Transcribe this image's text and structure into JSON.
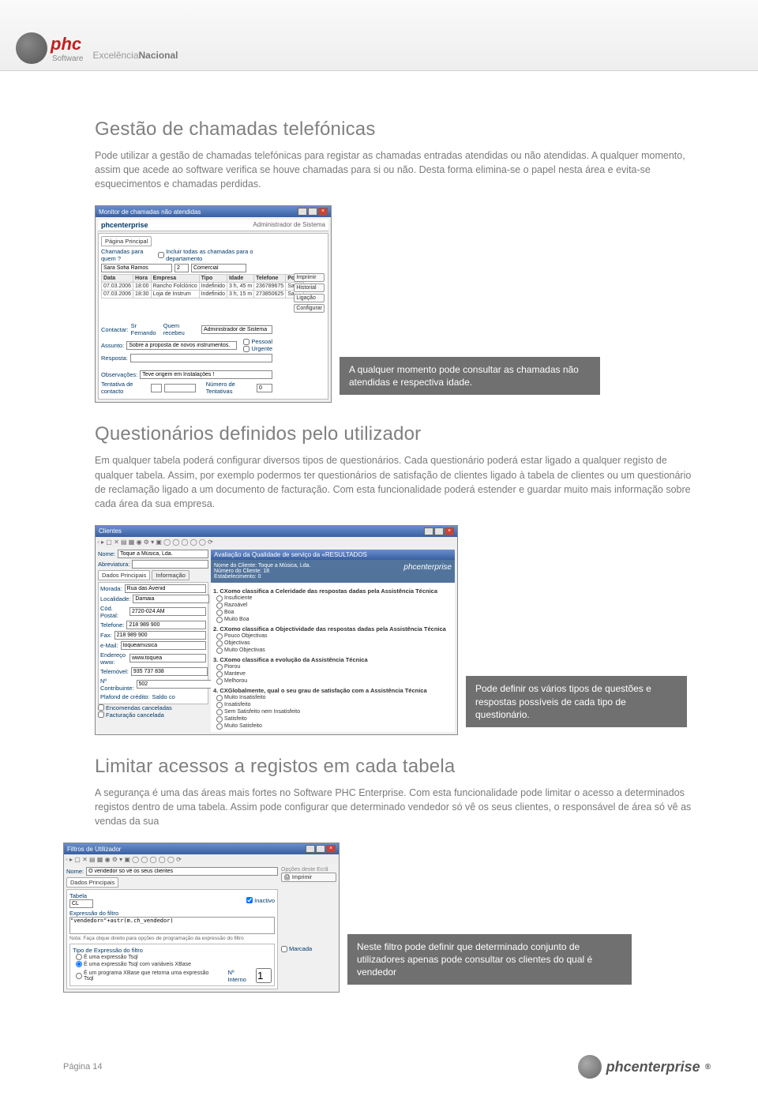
{
  "header": {
    "logo_text": "phc",
    "logo_sub": "Software",
    "tagline_light": "Excelência",
    "tagline_bold": "Nacional"
  },
  "sections": {
    "s1": {
      "title": "Gestão de chamadas telefónicas",
      "text": "Pode utilizar a gestão de chamadas telefónicas para registar as chamadas entradas atendidas ou não atendidas. A qualquer momento, assim que acede ao software verifica se houve chamadas para si ou não. Desta forma elimina-se o papel nesta área e evita-se esquecimentos e chamadas perdidas.",
      "caption": "A qualquer momento pode consultar as chamadas não atendidas e respectiva idade."
    },
    "s2": {
      "title": "Questionários definidos pelo utilizador",
      "text": "Em qualquer tabela poderá configurar diversos tipos de questionários. Cada questionário poderá estar ligado a qualquer registo de qualquer tabela. Assim, por exemplo podermos ter questionários de satisfação de clientes ligado à tabela de clientes ou um questionário de reclamação ligado a um documento de facturação. Com esta funcionalidade poderá estender e guardar muito mais informação sobre cada área da sua empresa.",
      "caption": "Pode definir os vários tipos de questões e respostas possíveis de cada tipo de questionário."
    },
    "s3": {
      "title": "Limitar acessos a registos em cada tabela",
      "text": "A segurança é uma das áreas mais fortes no Software PHC Enterprise. Com esta funcionalidade pode limitar o acesso a determinados registos dentro de uma tabela. Assim pode configurar que determinado vendedor só vê os seus clientes, o responsável de área só vê as vendas da sua",
      "caption": "Neste filtro pode definir que determinado conjunto de utilizadores apenas pode consultar os clientes do qual é vendedor"
    }
  },
  "win1": {
    "title": "Monitor de chamadas não atendidas",
    "brand": "phcenterprise",
    "role": "Administrador de Sistema",
    "tab": "Página Principal",
    "label_quem": "Chamadas para quem ?",
    "person": "Sara Sofia Ramos",
    "chk_all": "Incluir todas as chamadas para o departamento",
    "dept": "Comercial",
    "cols": [
      "Data",
      "Hora",
      "Empresa",
      "Tipo",
      "Idade",
      "Telefone",
      "Por a"
    ],
    "rows": [
      [
        "07.03.2006",
        "18:00",
        "Rancho Folclórico",
        "Indefinido",
        "3 h, 45 m",
        "236789675",
        "Sa"
      ],
      [
        "07.03.2006",
        "18:30",
        "Loja de Instrum",
        "Indefinido",
        "3 h, 15 m",
        "273850625",
        "Sa"
      ]
    ],
    "label_contactar": "Contactar:",
    "contactar": "Sr Fernando",
    "label_quem_rec": "Quem recebeu",
    "quem_rec": "Administrador de Sistema",
    "label_assunto": "Assunto:",
    "assunto": "Sobre a proposta de novos instrumentos.",
    "chk_pessoal": "Pessoal",
    "chk_urgente": "Urgente",
    "label_resposta": "Resposta:",
    "label_obs": "Observações:",
    "obs": "Teve origem em Instalações !",
    "label_tentativa": "Tentativa de contacto",
    "label_numtent": "Número de Tentativas",
    "num_tent": "0",
    "side": [
      "Imprimir",
      "Historial",
      "Ligação",
      "Configurar"
    ]
  },
  "win2": {
    "title": "Clientes",
    "brand": "phcenterprise",
    "panel_title": "Avaliação da Qualidade de serviço da «RESULTADOS",
    "nome_label": "Nome:",
    "nome": "Toque a Música, Lda.",
    "abrev_label": "Abreviatura:",
    "head_cli": "Nome do Cliente: Toque a Música, Lda.",
    "head_num": "Número do Cliente: 18",
    "head_est": "Estabelecimento: 0",
    "tab1": "Dados Principais",
    "tab2": "Informação",
    "morada_label": "Morada:",
    "morada": "Rua das Avenid",
    "local_label": "Localidade:",
    "local": "Damaia",
    "cp_label": "Cód. Postal:",
    "cp": "2720-024 AM",
    "tel_label": "Telefone:",
    "tel": "218 989 900",
    "fax_label": "Fax:",
    "fax": "218 989 900",
    "email_label": "e-Mail:",
    "email": "toqueamusica",
    "url_label": "Endereço www:",
    "url": "www.toquea",
    "telemovel_label": "Telemóvel:",
    "telemovel": "935 737 838",
    "contrib_label": "Nº Contribuinte:",
    "contrib": "502",
    "plafond_label": "Plafond de crédito:",
    "saldo_label": "Saldo co",
    "chk_enc": "Encomendas canceladas",
    "chk_fact": "Facturação cancelada",
    "q1": "1. CXomo classifica a Celeridade das respostas dadas pela Assistência Técnica",
    "q1opts": [
      "Insuficiente",
      "Razoável",
      "Boa",
      "Muito Boa"
    ],
    "q2": "2. CXomo classifica a Objectividade das respostas dadas pela Assistência Técnica",
    "q2opts": [
      "Pouco Objectivas",
      "Objectivas",
      "Muito Objectivas"
    ],
    "q3": "3. CXomo classifica a evolução da Assistência Técnica",
    "q3opts": [
      "Piorou",
      "Manteve",
      "Melhorou"
    ],
    "q4": "4. CXGlobalmente, qual o seu grau de satisfação com a Assistência Técnica",
    "q4opts": [
      "Muito Insatisfeito",
      "Insatisfeito",
      "Sem Satisfeito nem Insatisfeito",
      "Satisfeito",
      "Muito Satisfeito"
    ]
  },
  "win3": {
    "title": "Filtros de Utilizador",
    "nome_label": "Nome:",
    "nome": "O vendedor só vê os seus clientes",
    "tab": "Dados Principais",
    "tabela_label": "Tabela",
    "tabela": "CL",
    "inactivo": "Inactivo",
    "expr_label": "Expressão do filtro",
    "expr": "\"vendedor=\"+astr(m.ch_vendedor)",
    "hint": "Nota: Faça clique direito para opções de programação da expressão do filtro",
    "grp_label": "Tipo de Expressão do filtro",
    "r1": "É uma expressão Tsql",
    "r2": "É uma expressão Tsql com variáveis XBase",
    "r3": "É um programa XBase que retorna uma expressão Tsql",
    "ninterno_label": "Nº Interno",
    "ninterno": "1",
    "opcoes_title": "Opções deste Ecrã",
    "imprimir": "Imprimir",
    "marcada": "Marcada"
  },
  "footer": {
    "page": "Página 14",
    "brand": "phcenterprise"
  }
}
